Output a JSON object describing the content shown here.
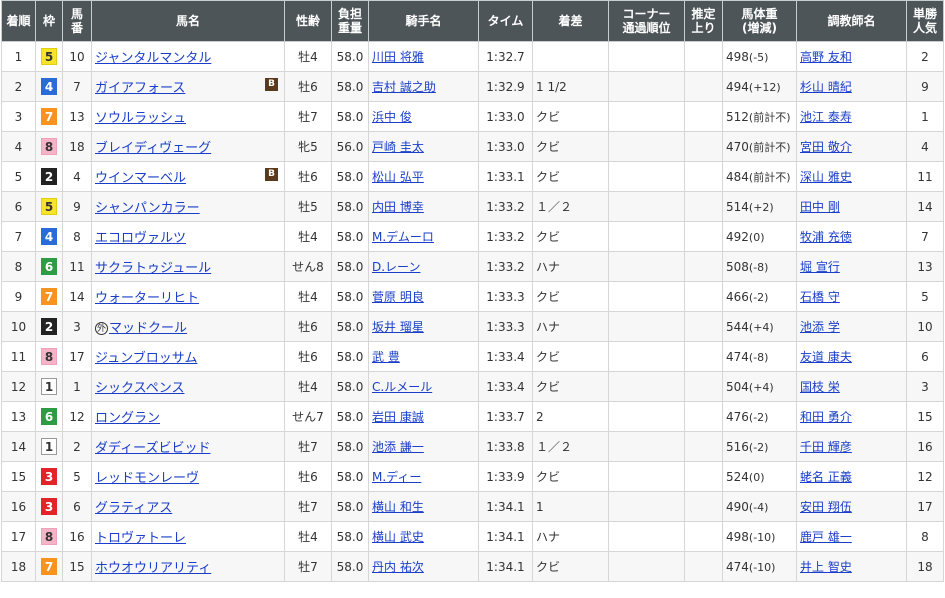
{
  "headers": {
    "rank": "着順",
    "waku": "枠",
    "num": "馬\n番",
    "horse": "馬名",
    "sexage": "性齢",
    "weight": "負担\n重量",
    "jockey": "騎手名",
    "time": "タイム",
    "margin": "着差",
    "corner": "コーナー\n通過順位",
    "last3f": "推定\n上り",
    "body": "馬体重\n(増減)",
    "trainer": "調教師名",
    "odds": "単勝\n人気"
  },
  "waku_colors": {
    "1": {
      "bg": "#ffffff",
      "fg": "#333333",
      "border": "#999999"
    },
    "2": {
      "bg": "#222222",
      "fg": "#ffffff",
      "border": "#222222"
    },
    "3": {
      "bg": "#e0242a",
      "fg": "#ffffff",
      "border": "#e0242a"
    },
    "4": {
      "bg": "#2a6bd8",
      "fg": "#ffffff",
      "border": "#2a6bd8"
    },
    "5": {
      "bg": "#f5e42a",
      "fg": "#333333",
      "border": "#e0cf10"
    },
    "6": {
      "bg": "#2e9b45",
      "fg": "#ffffff",
      "border": "#2e9b45"
    },
    "7": {
      "bg": "#f7931e",
      "fg": "#ffffff",
      "border": "#f7931e"
    },
    "8": {
      "bg": "#f5b3c8",
      "fg": "#333333",
      "border": "#f0a0b8"
    }
  },
  "rows": [
    {
      "rank": "1",
      "waku": "5",
      "num": "10",
      "horse": "ジャンタルマンタル",
      "blinker": "",
      "mark": "",
      "sexage": "牡4",
      "weight": "58.0",
      "jockey": "川田 将雅",
      "time": "1:32.7",
      "margin": "",
      "corner": "",
      "last3f": "",
      "body_weight": "498",
      "body_diff": "(-5)",
      "trainer": "高野 友和",
      "popularity": "2"
    },
    {
      "rank": "2",
      "waku": "4",
      "num": "7",
      "horse": "ガイアフォース",
      "blinker": "B",
      "mark": "",
      "sexage": "牡6",
      "weight": "58.0",
      "jockey": "吉村 誠之助",
      "time": "1:32.9",
      "margin": "1 1/2",
      "corner": "",
      "last3f": "",
      "body_weight": "494",
      "body_diff": "(+12)",
      "trainer": "杉山 晴紀",
      "popularity": "9"
    },
    {
      "rank": "3",
      "waku": "7",
      "num": "13",
      "horse": "ソウルラッシュ",
      "blinker": "",
      "mark": "",
      "sexage": "牡7",
      "weight": "58.0",
      "jockey": "浜中 俊",
      "time": "1:33.0",
      "margin": "クビ",
      "corner": "",
      "last3f": "",
      "body_weight": "512",
      "body_diff": "(前計不)",
      "trainer": "池江 泰寿",
      "popularity": "1"
    },
    {
      "rank": "4",
      "waku": "8",
      "num": "18",
      "horse": "ブレイディヴェーグ",
      "blinker": "",
      "mark": "",
      "sexage": "牝5",
      "weight": "56.0",
      "jockey": "戸崎 圭太",
      "time": "1:33.0",
      "margin": "クビ",
      "corner": "",
      "last3f": "",
      "body_weight": "470",
      "body_diff": "(前計不)",
      "trainer": "宮田 敬介",
      "popularity": "4"
    },
    {
      "rank": "5",
      "waku": "2",
      "num": "4",
      "horse": "ウインマーベル",
      "blinker": "B",
      "mark": "",
      "sexage": "牡6",
      "weight": "58.0",
      "jockey": "松山 弘平",
      "time": "1:33.1",
      "margin": "クビ",
      "corner": "",
      "last3f": "",
      "body_weight": "484",
      "body_diff": "(前計不)",
      "trainer": "深山 雅史",
      "popularity": "11"
    },
    {
      "rank": "6",
      "waku": "5",
      "num": "9",
      "horse": "シャンパンカラー",
      "blinker": "",
      "mark": "",
      "sexage": "牡5",
      "weight": "58.0",
      "jockey": "内田 博幸",
      "time": "1:33.2",
      "margin": "１／２",
      "corner": "",
      "last3f": "",
      "body_weight": "514",
      "body_diff": "(+2)",
      "trainer": "田中 剛",
      "popularity": "14"
    },
    {
      "rank": "7",
      "waku": "4",
      "num": "8",
      "horse": "エコロヴァルツ",
      "blinker": "",
      "mark": "",
      "sexage": "牡4",
      "weight": "58.0",
      "jockey": "M.デムーロ",
      "time": "1:33.2",
      "margin": "クビ",
      "corner": "",
      "last3f": "",
      "body_weight": "492",
      "body_diff": "(0)",
      "trainer": "牧浦 充徳",
      "popularity": "7"
    },
    {
      "rank": "8",
      "waku": "6",
      "num": "11",
      "horse": "サクラトゥジュール",
      "blinker": "",
      "mark": "",
      "sexage": "せん8",
      "weight": "58.0",
      "jockey": "D.レーン",
      "time": "1:33.2",
      "margin": "ハナ",
      "corner": "",
      "last3f": "",
      "body_weight": "508",
      "body_diff": "(-8)",
      "trainer": "堀 宣行",
      "popularity": "13"
    },
    {
      "rank": "9",
      "waku": "7",
      "num": "14",
      "horse": "ウォーターリヒト",
      "blinker": "",
      "mark": "",
      "sexage": "牡4",
      "weight": "58.0",
      "jockey": "菅原 明良",
      "time": "1:33.3",
      "margin": "クビ",
      "corner": "",
      "last3f": "",
      "body_weight": "466",
      "body_diff": "(-2)",
      "trainer": "石橋 守",
      "popularity": "5"
    },
    {
      "rank": "10",
      "waku": "2",
      "num": "3",
      "horse": "マッドクール",
      "blinker": "",
      "mark": "外",
      "sexage": "牡6",
      "weight": "58.0",
      "jockey": "坂井 瑠星",
      "time": "1:33.3",
      "margin": "ハナ",
      "corner": "",
      "last3f": "",
      "body_weight": "544",
      "body_diff": "(+4)",
      "trainer": "池添 学",
      "popularity": "10"
    },
    {
      "rank": "11",
      "waku": "8",
      "num": "17",
      "horse": "ジュンブロッサム",
      "blinker": "",
      "mark": "",
      "sexage": "牡6",
      "weight": "58.0",
      "jockey": "武 豊",
      "time": "1:33.4",
      "margin": "クビ",
      "corner": "",
      "last3f": "",
      "body_weight": "474",
      "body_diff": "(-8)",
      "trainer": "友道 康夫",
      "popularity": "6"
    },
    {
      "rank": "12",
      "waku": "1",
      "num": "1",
      "horse": "シックスペンス",
      "blinker": "",
      "mark": "",
      "sexage": "牡4",
      "weight": "58.0",
      "jockey": "C.ルメール",
      "time": "1:33.4",
      "margin": "クビ",
      "corner": "",
      "last3f": "",
      "body_weight": "504",
      "body_diff": "(+4)",
      "trainer": "国枝 栄",
      "popularity": "3"
    },
    {
      "rank": "13",
      "waku": "6",
      "num": "12",
      "horse": "ロングラン",
      "blinker": "",
      "mark": "",
      "sexage": "せん7",
      "weight": "58.0",
      "jockey": "岩田 康誠",
      "time": "1:33.7",
      "margin": "2",
      "corner": "",
      "last3f": "",
      "body_weight": "476",
      "body_diff": "(-2)",
      "trainer": "和田 勇介",
      "popularity": "15"
    },
    {
      "rank": "14",
      "waku": "1",
      "num": "2",
      "horse": "ダディーズビビッド",
      "blinker": "",
      "mark": "",
      "sexage": "牡7",
      "weight": "58.0",
      "jockey": "池添 謙一",
      "time": "1:33.8",
      "margin": "１／２",
      "corner": "",
      "last3f": "",
      "body_weight": "516",
      "body_diff": "(-2)",
      "trainer": "千田 輝彦",
      "popularity": "16"
    },
    {
      "rank": "15",
      "waku": "3",
      "num": "5",
      "horse": "レッドモンレーヴ",
      "blinker": "",
      "mark": "",
      "sexage": "牡6",
      "weight": "58.0",
      "jockey": "M.ディー",
      "time": "1:33.9",
      "margin": "クビ",
      "corner": "",
      "last3f": "",
      "body_weight": "524",
      "body_diff": "(0)",
      "trainer": "蛯名 正義",
      "popularity": "12"
    },
    {
      "rank": "16",
      "waku": "3",
      "num": "6",
      "horse": "グラティアス",
      "blinker": "",
      "mark": "",
      "sexage": "牡7",
      "weight": "58.0",
      "jockey": "横山 和生",
      "time": "1:34.1",
      "margin": "1",
      "corner": "",
      "last3f": "",
      "body_weight": "490",
      "body_diff": "(-4)",
      "trainer": "安田 翔伍",
      "popularity": "17"
    },
    {
      "rank": "17",
      "waku": "8",
      "num": "16",
      "horse": "トロヴァトーレ",
      "blinker": "",
      "mark": "",
      "sexage": "牡4",
      "weight": "58.0",
      "jockey": "横山 武史",
      "time": "1:34.1",
      "margin": "ハナ",
      "corner": "",
      "last3f": "",
      "body_weight": "498",
      "body_diff": "(-10)",
      "trainer": "鹿戸 雄一",
      "popularity": "8"
    },
    {
      "rank": "18",
      "waku": "7",
      "num": "15",
      "horse": "ホウオウリアリティ",
      "blinker": "",
      "mark": "",
      "sexage": "牡7",
      "weight": "58.0",
      "jockey": "丹内 祐次",
      "time": "1:34.1",
      "margin": "クビ",
      "corner": "",
      "last3f": "",
      "body_weight": "474",
      "body_diff": "(-10)",
      "trainer": "井上 智史",
      "popularity": "18"
    }
  ]
}
